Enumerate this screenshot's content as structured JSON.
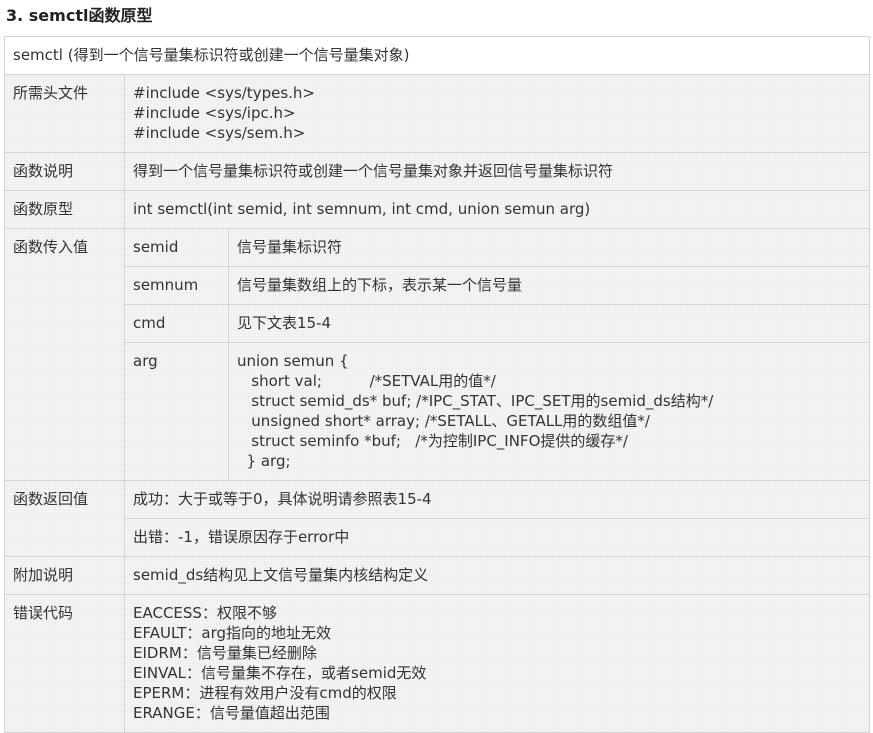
{
  "heading": "3.   semctl函数原型",
  "table": {
    "title": "semctl (得到一个信号量集标识符或创建一个信号量集对象)",
    "headers_row": {
      "label": "所需头文件",
      "lines": [
        "#include <sys/types.h>",
        "#include <sys/ipc.h>",
        "#include <sys/sem.h>"
      ]
    },
    "description_row": {
      "label": "函数说明",
      "value": "得到一个信号量集标识符或创建一个信号量集对象并返回信号量集标识符"
    },
    "prototype_row": {
      "label": "函数原型",
      "value": "int semctl(int semid, int semnum, int cmd, union semun arg)"
    },
    "params": {
      "label": "函数传入值",
      "items": [
        {
          "name": "semid",
          "desc": "信号量集标识符"
        },
        {
          "name": "semnum",
          "desc": "信号量集数组上的下标，表示某一个信号量"
        },
        {
          "name": "cmd",
          "desc": "见下文表15-4"
        }
      ],
      "arg": {
        "name": "arg",
        "lines": [
          "union semun {",
          "   short val;          /*SETVAL用的值*/",
          "   struct semid_ds* buf; /*IPC_STAT、IPC_SET用的semid_ds结构*/",
          "   unsigned short* array; /*SETALL、GETALL用的数组值*/",
          "   struct seminfo *buf;   /*为控制IPC_INFO提供的缓存*/",
          "  } arg;"
        ]
      }
    },
    "return_row": {
      "label": "函数返回值",
      "success": "成功：大于或等于0，具体说明请参照表15-4",
      "error": "出错：-1，错误原因存于error中"
    },
    "notes_row": {
      "label": "附加说明",
      "value": "semid_ds结构见上文信号量集内核结构定义"
    },
    "errors_row": {
      "label": "错误代码",
      "lines": [
        "EACCESS：权限不够",
        "EFAULT：arg指向的地址无效",
        "EIDRM：信号量集已经删除",
        "EINVAL：信号量集不存在，或者semid无效",
        "EPERM：进程有效用户没有cmd的权限",
        "ERANGE：信号量值超出范围"
      ]
    }
  }
}
